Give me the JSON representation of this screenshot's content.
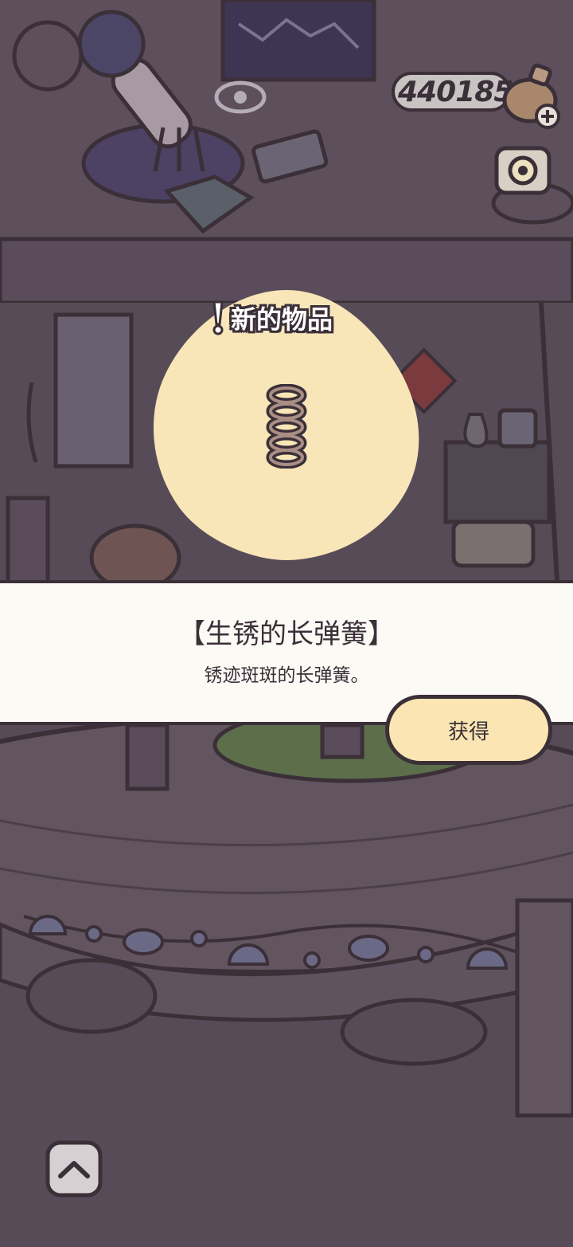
{
  "hud": {
    "coin_count": "440185",
    "coin_icon": "clover-pot-icon",
    "camera_icon": "camera-icon"
  },
  "popup": {
    "header": "新的物品",
    "item_icon": "rusty-spring-icon",
    "item_name": "【生锈的长弹簧】",
    "item_description": "锈迹斑斑的长弹簧。",
    "obtain_label": "获得"
  },
  "nav": {
    "expand_icon": "chevron-up-icon"
  },
  "colors": {
    "background": "#584b58",
    "panel": "#fcfaf5",
    "reveal_blob": "#f8e6b8",
    "button": "#fbe6b3",
    "outline": "#3b2f38"
  }
}
